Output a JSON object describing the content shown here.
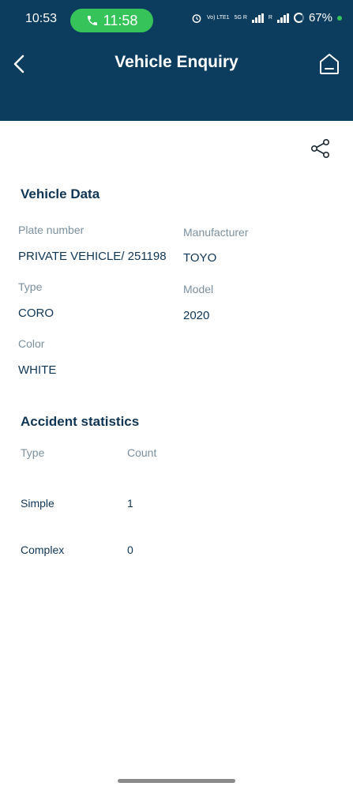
{
  "status_bar": {
    "time": "10:53",
    "call_timer": "11:58",
    "network_vo": "Vo) LTE1",
    "network_5g": "5G R",
    "signal_r": "R",
    "battery": "67%",
    "call_color": "#35c35a"
  },
  "header": {
    "title": "Vehicle Enquiry",
    "background": "#0d3d5e",
    "back_icon": "chevron-left-icon",
    "home_icon": "home-icon"
  },
  "actions": {
    "share_icon": "share-icon"
  },
  "vehicle_data": {
    "title": "Vehicle Data",
    "plate_number_label": "Plate number",
    "plate_number_value": "PRIVATE VEHICLE/ 251198",
    "manufacturer_label": "Manufacturer",
    "manufacturer_value": "TOYO",
    "type_label": "Type",
    "type_value": "CORO",
    "model_label": "Model",
    "model_value": "2020",
    "color_label": "Color",
    "color_value": "WHITE"
  },
  "accident_statistics": {
    "title": "Accident statistics",
    "headers": {
      "type": "Type",
      "count": "Count"
    },
    "rows": [
      {
        "type": "Simple",
        "count": "1"
      },
      {
        "type": "Complex",
        "count": "0"
      }
    ]
  }
}
